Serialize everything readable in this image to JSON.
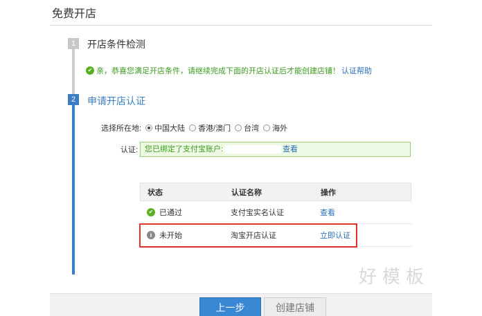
{
  "page": {
    "title": "免费开店"
  },
  "steps": [
    {
      "num": "1",
      "label": "开店条件检测"
    },
    {
      "num": "2",
      "label": "申请开店认证"
    }
  ],
  "notice": {
    "text": "亲，恭喜您满足开店条件，请继续完成下面的开店认证后才能创建店铺！",
    "link": "认证帮助"
  },
  "region": {
    "label": "选择所在地:",
    "options": [
      "中国大陆",
      "香港/澳门",
      "台湾",
      "海外"
    ],
    "selected": "中国大陆"
  },
  "auth": {
    "label": "认证:",
    "text": "您已绑定了支付宝账户:",
    "link": "查看"
  },
  "table": {
    "headers": [
      "状态",
      "认证名称",
      "操作"
    ],
    "rows": [
      {
        "status": "已通过",
        "name": "支付宝实名认证",
        "action": "查看"
      },
      {
        "status": "未开始",
        "name": "淘宝开店认证",
        "action": "立即认证"
      }
    ]
  },
  "watermark": "好模板",
  "buttons": {
    "prev": "上一步",
    "create": "创建店铺"
  },
  "colors": {
    "accent": "#3a7fc6",
    "success": "#3c9a20",
    "highlight": "#e1322d"
  },
  "icons": {
    "passed": "check-circle-icon",
    "pending": "info-circle-icon"
  }
}
